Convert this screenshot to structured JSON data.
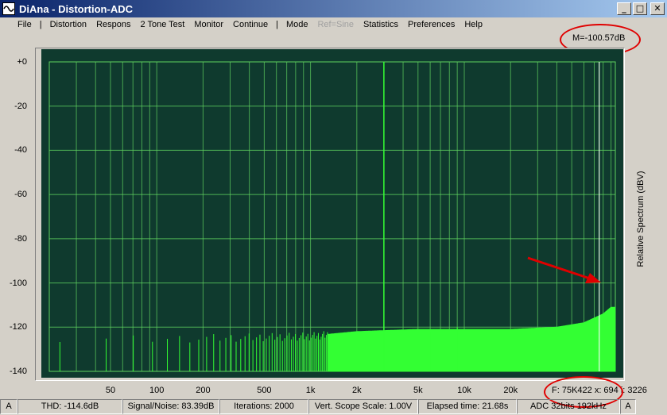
{
  "window": {
    "title": "DiAna - Distortion-ADC",
    "minimize": "_",
    "maximize": "□",
    "close": "✕"
  },
  "menu": {
    "items": [
      {
        "label": "File",
        "enabled": true
      },
      {
        "label": "|",
        "separator": true
      },
      {
        "label": "Distortion",
        "enabled": true
      },
      {
        "label": "Respons",
        "enabled": true
      },
      {
        "label": "2 Tone Test",
        "enabled": true
      },
      {
        "label": "Monitor",
        "enabled": true
      },
      {
        "label": "Continue",
        "enabled": true
      },
      {
        "label": "|",
        "separator": true
      },
      {
        "label": "Mode",
        "enabled": true
      },
      {
        "label": "Ref=Sine",
        "enabled": false
      },
      {
        "label": "Statistics",
        "enabled": true
      },
      {
        "label": "Preferences",
        "enabled": true
      },
      {
        "label": "Help",
        "enabled": true
      }
    ]
  },
  "marker": {
    "readout": "M=-100.57dB",
    "frequency_readout": "F: 75K422 x: 694 i: 3226"
  },
  "annotation": {
    "highlight_color": "#e00000"
  },
  "colors": {
    "plot_background": "#0f3a2e",
    "grid": "#5fd15f",
    "spectrum": "#33ff33",
    "marker_line": "#e8ffe8"
  },
  "chart_data": {
    "type": "line",
    "ylabel": "Relative Spectrum (dBV)",
    "y_scale": "linear",
    "x_scale": "log",
    "ylim": [
      -140,
      0
    ],
    "xlim": [
      20,
      96000
    ],
    "y_ticks": [
      "+0",
      "-20",
      "-40",
      "-60",
      "-80",
      "-100",
      "-120",
      "-140"
    ],
    "x_ticks": [
      {
        "value": 50,
        "label": "50"
      },
      {
        "value": 100,
        "label": "100"
      },
      {
        "value": 200,
        "label": "200"
      },
      {
        "value": 500,
        "label": "500"
      },
      {
        "value": 1000,
        "label": "1k"
      },
      {
        "value": 2000,
        "label": "2k"
      },
      {
        "value": 5000,
        "label": "5k"
      },
      {
        "value": 10000,
        "label": "10k"
      },
      {
        "value": 20000,
        "label": "20k"
      }
    ],
    "grid": true,
    "fundamental": {
      "frequency": 3000,
      "level": 0
    },
    "harmonics": [
      {
        "frequency": 6000,
        "level": -122
      },
      {
        "frequency": 9000,
        "level": -120
      }
    ],
    "noise_floor": [
      {
        "frequency": 20,
        "level": -128
      },
      {
        "frequency": 1000,
        "level": -126
      },
      {
        "frequency": 2000,
        "level": -124
      },
      {
        "frequency": 5000,
        "level": -123
      },
      {
        "frequency": 20000,
        "level": -123
      },
      {
        "frequency": 40000,
        "level": -122
      },
      {
        "frequency": 60000,
        "level": -120
      },
      {
        "frequency": 80000,
        "level": -116
      },
      {
        "frequency": 90000,
        "level": -113
      }
    ],
    "marker": {
      "frequency": 75422,
      "level": -100.57
    }
  },
  "status": {
    "cells": [
      {
        "text": "A"
      },
      {
        "text": "THD: -114.6dB"
      },
      {
        "text": "Signal/Noise:  83.39dB"
      },
      {
        "text": "Iterations: 2000"
      },
      {
        "text": "Vert. Scope Scale: 1.00V"
      },
      {
        "text": "Elapsed time: 21.68s"
      },
      {
        "text": "ADC 32bits 192kHz"
      },
      {
        "text": "A"
      }
    ]
  }
}
